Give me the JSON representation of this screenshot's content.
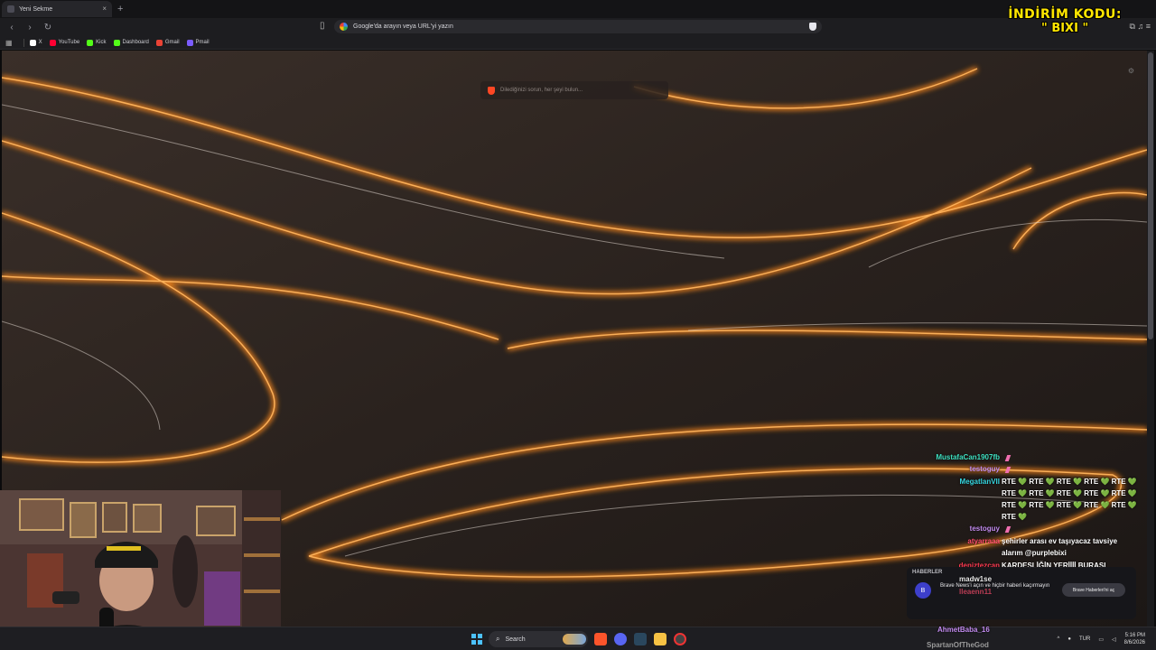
{
  "browser": {
    "tab_title": "Yeni Sekme",
    "tab_close": "×",
    "new_tab": "+",
    "url_placeholder": "Google'da arayın veya URL'yi yazın"
  },
  "bookmarks": [
    {
      "label": "X",
      "color": "#ffffff"
    },
    {
      "label": "YouTube",
      "color": "#ff0033"
    },
    {
      "label": "Kick",
      "color": "#53fc18"
    },
    {
      "label": "Dashboard",
      "color": "#53fc18"
    },
    {
      "label": "Gmail",
      "color": "#ea4335"
    },
    {
      "label": "Pmail",
      "color": "#7b5cff"
    }
  ],
  "overlay": {
    "promo_line1": "İNDİRİM KODU:",
    "promo_line2": "\" BIXI \""
  },
  "newtab": {
    "search_placeholder": "Dilediğinizi sorun, her şeyi bulun..."
  },
  "chat": [
    {
      "user": "MustafaCan1907fb",
      "color": "#3ee0c1",
      "msg": "",
      "badge": true
    },
    {
      "user": "testoguy",
      "color": "#c38cf0",
      "msg": "",
      "badge": true
    },
    {
      "user": "MegatlanVII",
      "color": "#35d6e0",
      "msg": "RTE 💚 RTE 💚 RTE 💚 RTE 💚 RTE 💚",
      "badge": false
    },
    {
      "user": "",
      "color": "#ffffff",
      "msg": "RTE 💚 RTE 💚 RTE 💚 RTE 💚 RTE 💚",
      "badge": false
    },
    {
      "user": "",
      "color": "#ffffff",
      "msg": "RTE 💚 RTE 💚 RTE 💚 RTE 💚 RTE 💚",
      "badge": false
    },
    {
      "user": "",
      "color": "#ffffff",
      "msg": "RTE 💚",
      "badge": false
    },
    {
      "user": "testoguy",
      "color": "#c38cf0",
      "msg": "",
      "badge": true
    },
    {
      "user": "atyarraaa",
      "color": "#ff4d6d",
      "msg": "şehirler arası ev taşıyacaz tavsiye",
      "badge": false
    },
    {
      "user": "",
      "color": "#ffffff",
      "msg": "alarım @purplebixi",
      "badge": false
    },
    {
      "user": "deniztezcan",
      "color": "#ff3a52",
      "msg": "KARDEŞLİĞİN YERİİİİ BURASI",
      "badge": false
    },
    {
      "user": "madw1se",
      "color": "#e8e8e8",
      "msg": "",
      "badge": false
    },
    {
      "user": "lleaenn11",
      "color": "#ff4d6d",
      "msg": "",
      "badge": false
    }
  ],
  "chat_bottom": {
    "user1": "AhmetBaba_16",
    "user2": "SpartanOfTheGod"
  },
  "toast": {
    "header": "HABERLER",
    "text": "Brave News'i açın ve hiçbir haberi kaçırmayın",
    "button": "Brave Haberleri'ni aç",
    "avatar": "B"
  },
  "taskbar": {
    "search_label": "Search",
    "lang": "TUR",
    "time": "5:16 PM",
    "date": "8/6/2026"
  }
}
